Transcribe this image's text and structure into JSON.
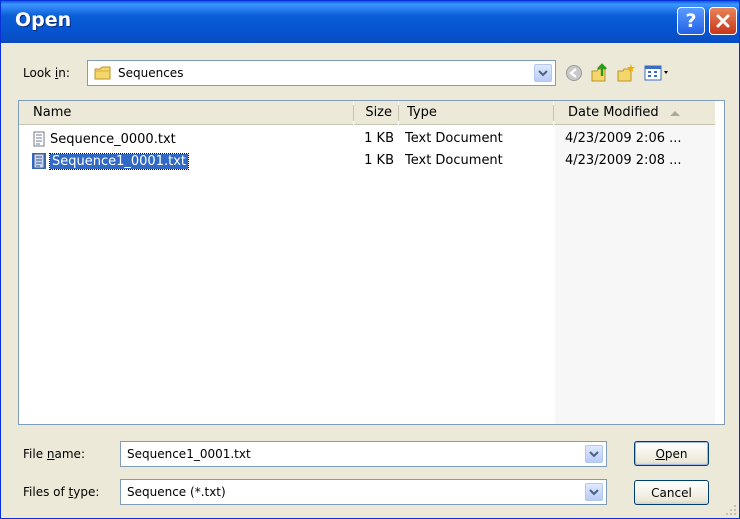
{
  "window": {
    "title": "Open"
  },
  "titlebar": {
    "help_icon": "help-icon",
    "close_icon": "close-icon"
  },
  "lookin": {
    "label_pre": "Look ",
    "label_key": "i",
    "label_post": "n:",
    "value": "Sequences",
    "folder_icon": "folder-icon"
  },
  "toolbar": [
    "back-icon",
    "up-folder-icon",
    "new-folder-icon",
    "view-menu-icon"
  ],
  "columns": {
    "name": "Name",
    "size": "Size",
    "type": "Type",
    "date": "Date Modified"
  },
  "files": [
    {
      "name": "Sequence_0000.txt",
      "size": "1 KB",
      "type": "Text Document",
      "date": "4/23/2009 2:06 ..."
    },
    {
      "name": "Sequence1_0001.txt",
      "size": "1 KB",
      "type": "Text Document",
      "date": "4/23/2009 2:08 ..."
    }
  ],
  "filename": {
    "label_pre": "File ",
    "label_key": "n",
    "label_post": "ame:",
    "value": "Sequence1_0001.txt"
  },
  "filetype": {
    "label_pre": "Files of ",
    "label_key": "t",
    "label_post": "ype:",
    "value": "Sequence (*.txt)"
  },
  "buttons": {
    "open_key": "O",
    "open_rest": "pen",
    "cancel": "Cancel"
  },
  "colors": {
    "titlebar": "#0554d0",
    "selection": "#316ac5",
    "dialog_bg": "#ece9d8",
    "field_border": "#7f9db9"
  }
}
